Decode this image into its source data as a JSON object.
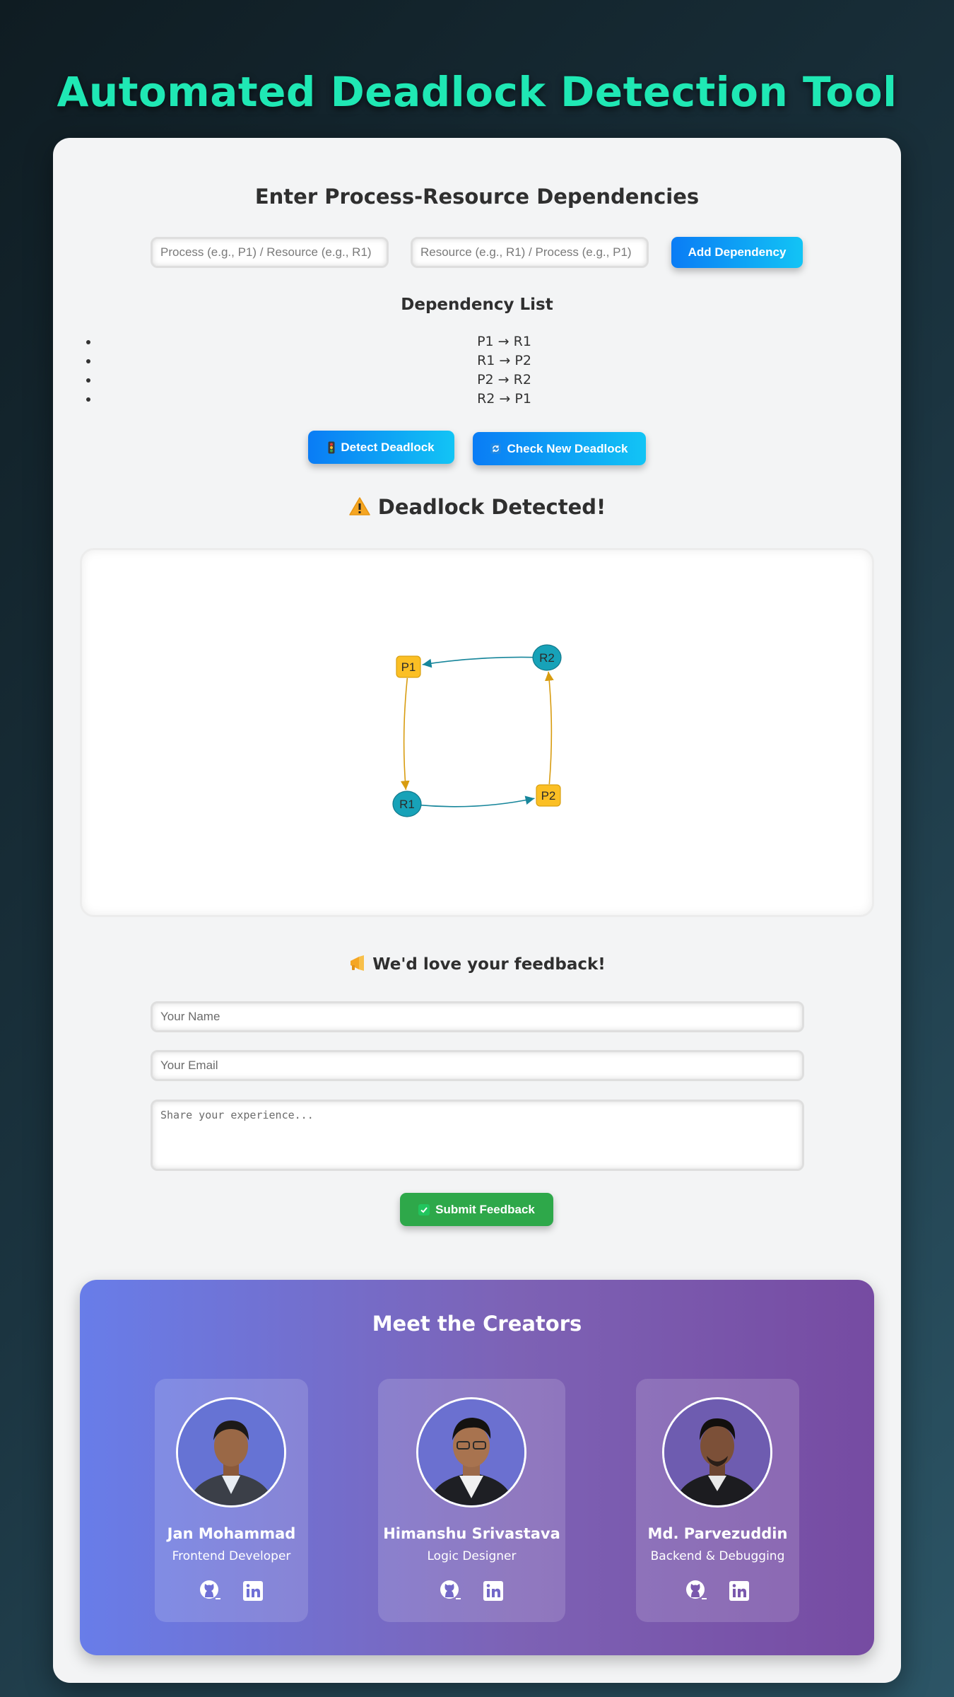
{
  "app": {
    "title": "Automated Deadlock Detection Tool"
  },
  "dependencies_section": {
    "title": "Enter Process-Resource Dependencies",
    "from_placeholder": "Process (e.g., P1) / Resource (e.g., R1)",
    "to_placeholder": "Resource (e.g., R1) / Process (e.g., P1)",
    "add_button": "Add Dependency",
    "list_title": "Dependency List",
    "items": [
      "P1 → R1",
      "R1 → P2",
      "P2 → R2",
      "R2 → P1"
    ]
  },
  "actions": {
    "detect_icon": "traffic-light-icon",
    "detect_label": "Detect Deadlock",
    "check_icon": "refresh-icon",
    "check_label": "Check New Deadlock"
  },
  "result": {
    "icon": "warning-icon",
    "text": "Deadlock Detected!"
  },
  "graph": {
    "colors": {
      "process": "#fbbf24",
      "resource": "#17a2b8",
      "process_edge": "#d89c10",
      "resource_edge": "#17869b"
    },
    "nodes": [
      {
        "id": "P1",
        "kind": "process"
      },
      {
        "id": "R1",
        "kind": "resource"
      },
      {
        "id": "P2",
        "kind": "process"
      },
      {
        "id": "R2",
        "kind": "resource"
      }
    ],
    "edges": [
      {
        "from": "P1",
        "to": "R1"
      },
      {
        "from": "R1",
        "to": "P2"
      },
      {
        "from": "P2",
        "to": "R2"
      },
      {
        "from": "R2",
        "to": "P1"
      }
    ]
  },
  "feedback": {
    "icon": "megaphone-icon",
    "title": "We'd love your feedback!",
    "name_placeholder": "Your Name",
    "email_placeholder": "Your Email",
    "message_placeholder": "Share your experience...",
    "submit_icon": "check-icon",
    "submit_label": "Submit Feedback"
  },
  "creators": {
    "title": "Meet the Creators",
    "people": [
      {
        "name": "Jan Mohammad",
        "role": "Frontend Developer"
      },
      {
        "name": "Himanshu Srivastava",
        "role": "Logic Designer"
      },
      {
        "name": "Md. Parvezuddin",
        "role": "Backend & Debugging"
      }
    ],
    "social_icons": [
      "github-icon",
      "linkedin-icon"
    ]
  }
}
